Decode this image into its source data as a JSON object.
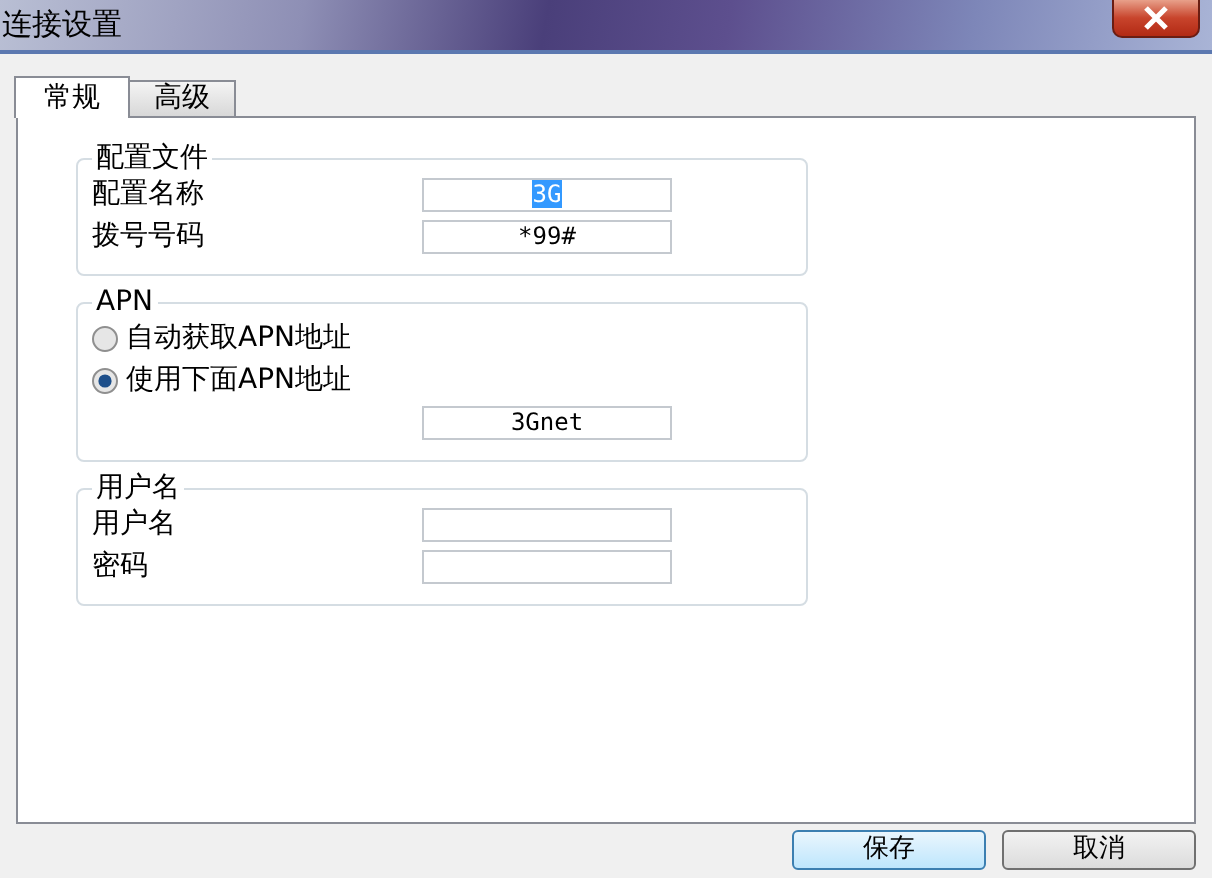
{
  "window": {
    "title": "连接设置"
  },
  "tabs": [
    {
      "label": "常规",
      "selected": true
    },
    {
      "label": "高级",
      "selected": false
    }
  ],
  "groups": [
    {
      "title": "配置文件",
      "rows": [
        {
          "kind": "field",
          "label": "配置名称",
          "value": "3G",
          "text_selected": true
        },
        {
          "kind": "field",
          "label": "拨号号码",
          "value": "*99#",
          "text_selected": false
        }
      ]
    },
    {
      "title": "APN",
      "rows": [
        {
          "kind": "radio",
          "label": "自动获取APN地址",
          "checked": false
        },
        {
          "kind": "radio",
          "label": "使用下面APN地址",
          "checked": true
        },
        {
          "kind": "field",
          "value": "3Gnet",
          "text_selected": false
        }
      ]
    },
    {
      "title": "用户名",
      "rows": [
        {
          "kind": "field",
          "label": "用户名"
        },
        {
          "kind": "field",
          "label": "密码"
        }
      ]
    }
  ],
  "buttons": [
    "保存",
    "取消"
  ]
}
